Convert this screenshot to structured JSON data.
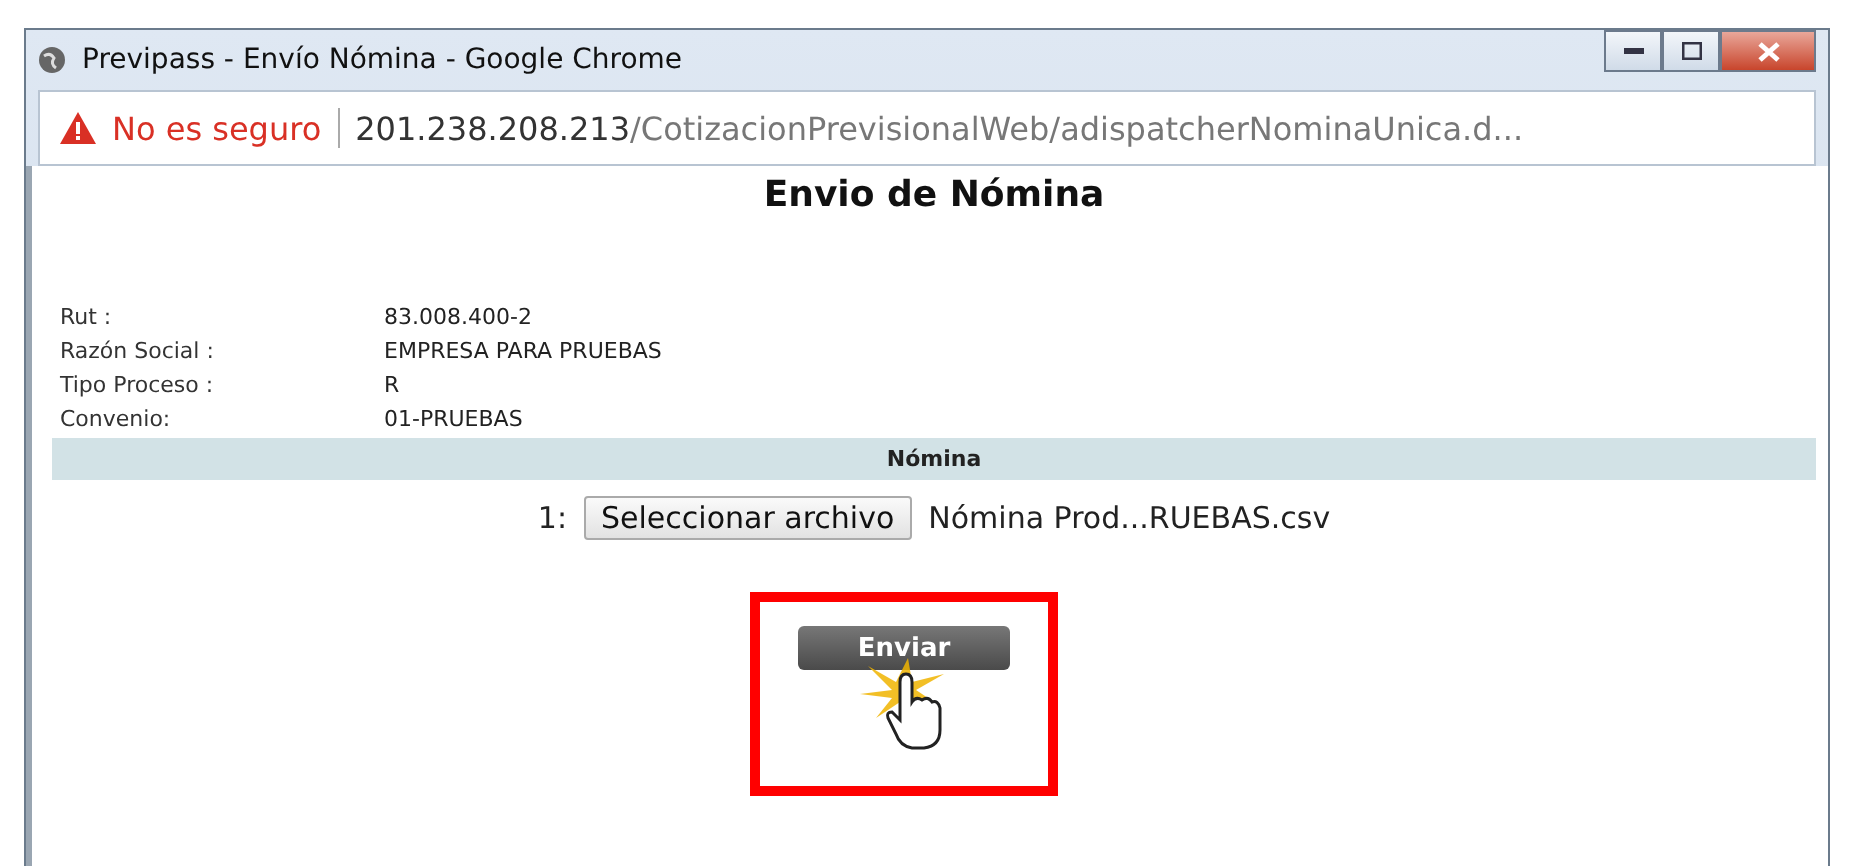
{
  "window": {
    "title": "Previpass - Envío Nómina - Google Chrome"
  },
  "address_bar": {
    "security": "No es seguro",
    "host": "201.238.208.213",
    "path": "/CotizacionPrevisionalWeb/adispatcherNominaUnica.d..."
  },
  "page": {
    "title": "Envio de Nómina",
    "fields": [
      {
        "label": "Rut :",
        "value": "83.008.400-2"
      },
      {
        "label": "Razón Social :",
        "value": "EMPRESA PARA PRUEBAS"
      },
      {
        "label": "Tipo Proceso :",
        "value": "R"
      },
      {
        "label": "Convenio:",
        "value": "01-PRUEBAS"
      }
    ],
    "section_header": "Nómina",
    "file_row": {
      "index": "1:",
      "button": "Seleccionar archivo",
      "file_name": "Nómina Prod...RUEBAS.csv"
    },
    "submit_button": "Enviar"
  }
}
